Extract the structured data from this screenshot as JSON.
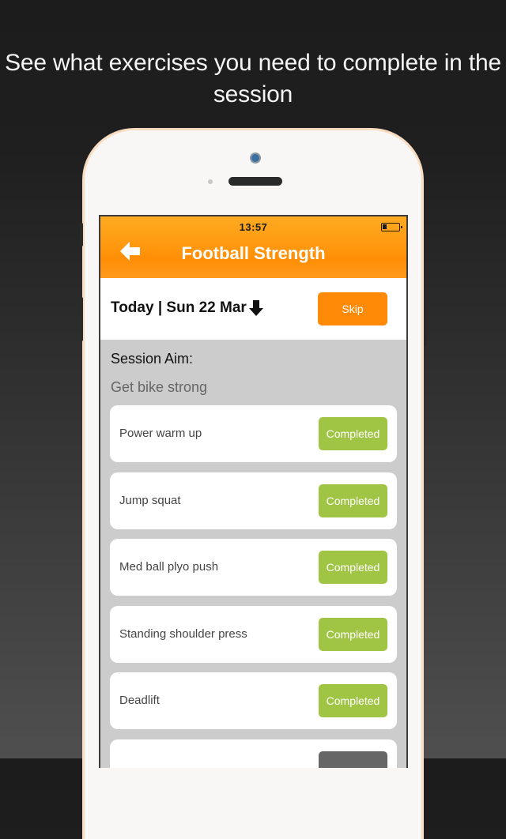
{
  "headline": "See what exercises you need to complete in the session",
  "status_bar": {
    "time": "13:57",
    "battery_icon": "battery-low-icon"
  },
  "nav": {
    "back_icon": "back-arrow-icon",
    "title": "Football Strength"
  },
  "date_bar": {
    "date_label": "Today | Sun 22 Mar",
    "dropdown_icon": "arrow-down-icon",
    "skip_label": "Skip"
  },
  "session": {
    "aim_label": "Session Aim:",
    "aim_value": "Get bike strong"
  },
  "exercises": [
    {
      "name": "Power warm up",
      "status": "Completed"
    },
    {
      "name": "Jump squat",
      "status": "Completed"
    },
    {
      "name": "Med ball plyo push",
      "status": "Completed"
    },
    {
      "name": "Standing shoulder press",
      "status": "Completed"
    },
    {
      "name": "Deadlift",
      "status": "Completed"
    },
    {
      "name": "",
      "status": ""
    }
  ],
  "colors": {
    "accent_orange": "#ff8a08",
    "completed_green": "#a0c545",
    "pending_gray": "#666666"
  }
}
